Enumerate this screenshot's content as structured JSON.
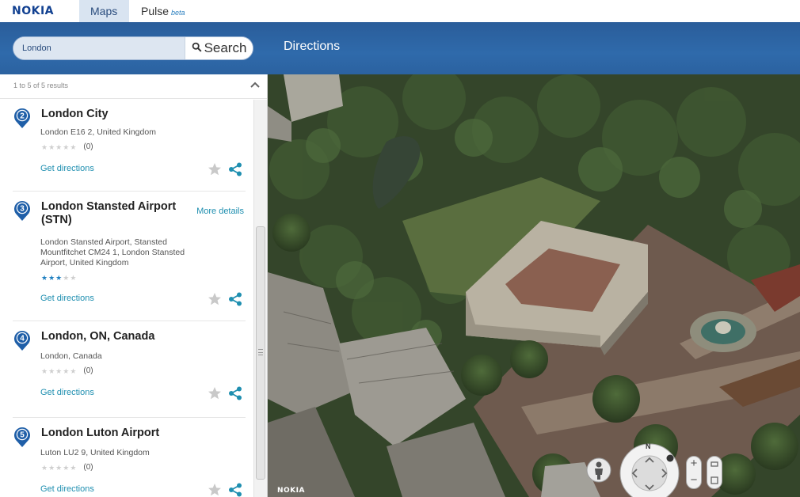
{
  "nav": {
    "logo": "NOKIA",
    "tabs": [
      {
        "label": "Maps",
        "active": true
      },
      {
        "label": "Pulse",
        "badge": "beta",
        "active": false
      }
    ]
  },
  "search": {
    "value": "London",
    "button_label": "Search",
    "directions_label": "Directions"
  },
  "results_panel": {
    "count_text": "1 to 5 of 5 results",
    "items": [
      {
        "number": "2",
        "title": "London City",
        "address_lines": [
          "London E16 2, United Kingdom"
        ],
        "rating": 0,
        "review_count": "(0)",
        "directions_label": "Get directions"
      },
      {
        "number": "3",
        "title_lines": [
          "London Stansted Airport",
          "(STN)"
        ],
        "more_details_label": "More details",
        "address_lines": [
          "London Stansted Airport, Stansted",
          "Mountfitchet CM24 1, London Stansted",
          "Airport, United Kingdom"
        ],
        "rating": 3,
        "directions_label": "Get directions"
      },
      {
        "number": "4",
        "title": "London, ON, Canada",
        "address_lines": [
          "London, Canada"
        ],
        "rating": 0,
        "review_count": "(0)",
        "directions_label": "Get directions"
      },
      {
        "number": "5",
        "title": "London Luton Airport",
        "address_lines": [
          "Luton LU2 9, United Kingdom"
        ],
        "rating": 0,
        "review_count": "(0)",
        "directions_label": "Get directions"
      }
    ]
  },
  "map": {
    "watermark": "NOKIA",
    "compass_north": "N",
    "zoom_in": "+",
    "zoom_out": "−"
  },
  "colors": {
    "brand": "#124191",
    "header_bar": "#2f6aab",
    "link": "#1f8fb0",
    "pin": "#1f5fa8",
    "star_active": "#1f7fc0"
  },
  "icons": [
    "search-icon",
    "chevron-up-icon",
    "map-pin-icon",
    "star-icon",
    "favorite-star-icon",
    "share-icon",
    "pegman-icon",
    "compass-icon",
    "zoom-in-icon",
    "zoom-out-icon",
    "tilt-icon"
  ]
}
